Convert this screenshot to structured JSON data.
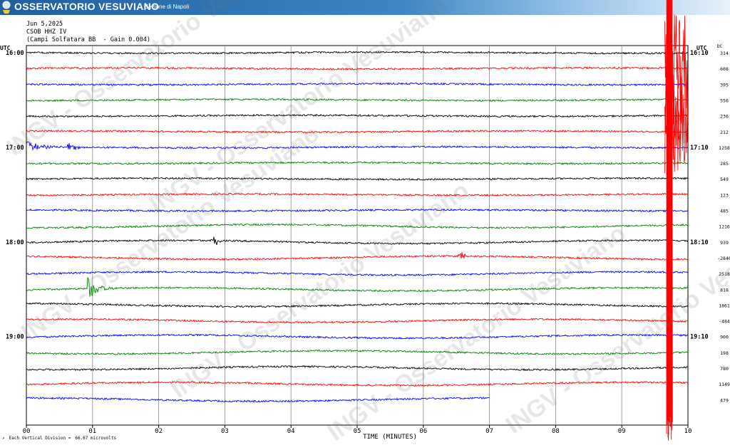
{
  "banner": {
    "title": "OSSERVATORIO VESUVIANO",
    "subtitle": "Sezione di Napoli",
    "logo_text": "INGV",
    "colors": {
      "start": "#1f5fa0",
      "end": "#e6f1fb"
    }
  },
  "header": {
    "date": "Jun 5,2025",
    "station": "CSOB HHZ IV",
    "description": "(Campi Solfatara BB  - Gain 0.004)"
  },
  "left_axis_title": "UTC",
  "right_axis_title": "UTC",
  "dc_title": "DC",
  "watermark_text": "INGV - Osservatorio Vesuviano",
  "footnote": {
    "label": "Each Vertical Division =",
    "value": "66.67 microvolts"
  },
  "chart_data": {
    "type": "line",
    "title": "",
    "xlabel": "TIME (MINUTES)",
    "ylabel": "UTC",
    "xlim": [
      0,
      10
    ],
    "x_ticks": [
      "00",
      "01",
      "02",
      "03",
      "04",
      "05",
      "06",
      "07",
      "08",
      "09",
      "10"
    ],
    "left_time_labels": [
      {
        "row": 0,
        "text": "16:00"
      },
      {
        "row": 6,
        "text": "17:00"
      },
      {
        "row": 12,
        "text": "18:00"
      },
      {
        "row": 18,
        "text": "19:00"
      }
    ],
    "right_time_labels": [
      {
        "row": 0,
        "text": "16:10"
      },
      {
        "row": 6,
        "text": "17:10"
      },
      {
        "row": 12,
        "text": "18:10"
      },
      {
        "row": 18,
        "text": "19:10"
      }
    ],
    "row_colors": [
      "#000000",
      "#ff0000",
      "#0000ff",
      "#008000"
    ],
    "dc_offsets": [
      "314",
      "608",
      "395",
      "556",
      "236",
      "212",
      "1258",
      "285",
      "549",
      "123",
      "485",
      "1216",
      "939",
      "-2840",
      "2518",
      "818",
      "1861",
      "-484",
      "900",
      "198",
      "780",
      "1149",
      "479"
    ],
    "last_row_end_minutes": 7.0,
    "grid": true,
    "events": [
      {
        "row": 6,
        "start_min": 0.0,
        "end_min": 0.55,
        "amplitude": 9,
        "kind": "decay"
      },
      {
        "row": 6,
        "start_min": 0.62,
        "end_min": 0.95,
        "amplitude": 7,
        "kind": "decay"
      },
      {
        "row": 12,
        "start_min": 2.78,
        "end_min": 2.95,
        "amplitude": 7,
        "kind": "burst"
      },
      {
        "row": 13,
        "start_min": 6.5,
        "end_min": 6.65,
        "amplitude": 6,
        "kind": "burst"
      },
      {
        "row": 15,
        "start_min": 0.92,
        "end_min": 1.35,
        "amplitude": 18,
        "kind": "decay"
      },
      {
        "row": 1,
        "start_min": 9.65,
        "end_min": 10.0,
        "amplitude": 80,
        "kind": "strong"
      },
      {
        "row": 3,
        "start_min": 9.65,
        "end_min": 10.0,
        "amplitude": 70,
        "kind": "strong"
      },
      {
        "row": 5,
        "start_min": 9.65,
        "end_min": 10.0,
        "amplitude": 60,
        "kind": "strong"
      }
    ]
  }
}
